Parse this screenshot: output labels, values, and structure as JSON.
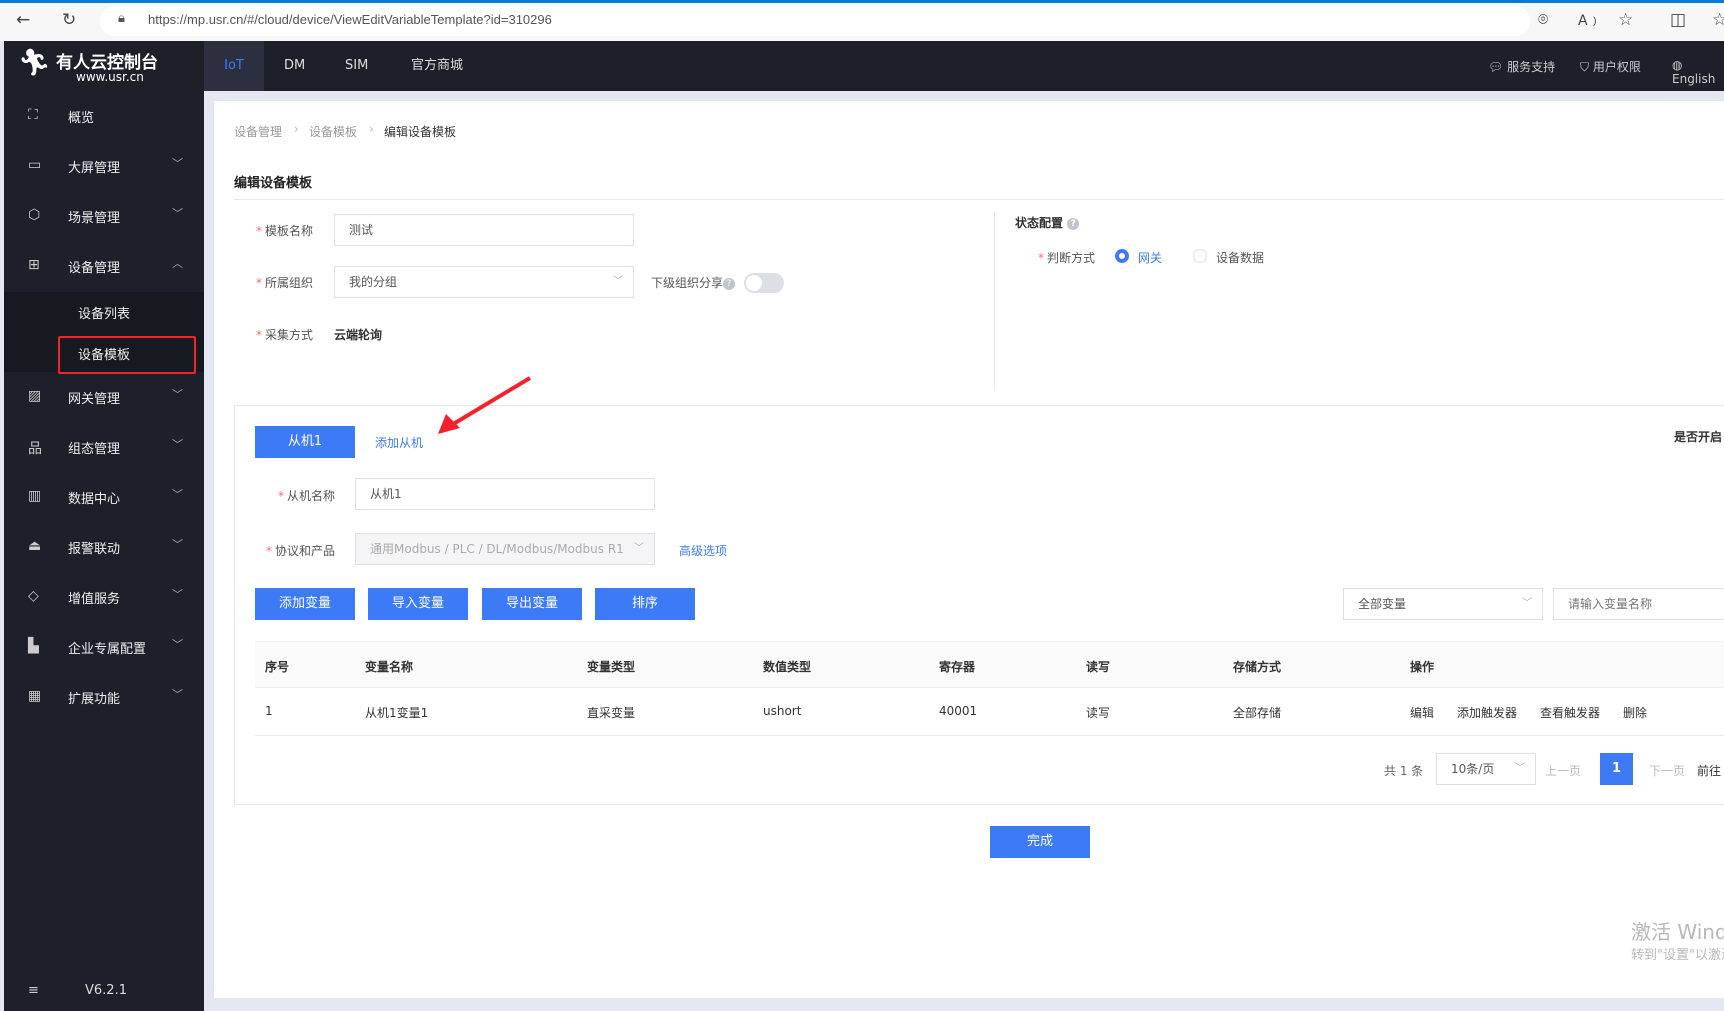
{
  "browser": {
    "url": "https://mp.usr.cn/#/cloud/device/ViewEditVariableTemplate?id=310296"
  },
  "header": {
    "logo_title": "有人云控制台",
    "logo_sub": "www.usr.cn",
    "tabs": [
      "IoT",
      "DM",
      "SIM",
      "官方商城"
    ],
    "active_tab": "IoT",
    "right": [
      {
        "icon": "chat-icon",
        "label": "服务支持"
      },
      {
        "icon": "shield-icon",
        "label": "用户权限"
      },
      {
        "icon": "globe-icon",
        "label": "English"
      }
    ]
  },
  "sidebar": {
    "items": [
      {
        "label": "概览",
        "icon": "overview-icon"
      },
      {
        "label": "大屏管理",
        "icon": "screen-icon"
      },
      {
        "label": "场景管理",
        "icon": "cube-icon"
      },
      {
        "label": "设备管理",
        "icon": "device-icon",
        "expanded": true,
        "children": [
          "设备列表",
          "设备模板"
        ],
        "selected_child": "设备模板"
      },
      {
        "label": "网关管理",
        "icon": "gateway-icon"
      },
      {
        "label": "组态管理",
        "icon": "hierarchy-icon"
      },
      {
        "label": "数据中心",
        "icon": "bar-chart-icon"
      },
      {
        "label": "报警联动",
        "icon": "alarm-icon"
      },
      {
        "label": "增值服务",
        "icon": "diamond-icon"
      },
      {
        "label": "企业专属配置",
        "icon": "building-icon"
      },
      {
        "label": "扩展功能",
        "icon": "grid-icon"
      }
    ],
    "version": "V6.2.1"
  },
  "breadcrumb": [
    "设备管理",
    "设备模板",
    "编辑设备模板"
  ],
  "page_title": "编辑设备模板",
  "form": {
    "template_name_label": "模板名称",
    "template_name_value": "测试",
    "org_label": "所属组织",
    "org_value": "我的分组",
    "share_label": "下级组织分享",
    "share_enabled": false,
    "collect_label": "采集方式",
    "collect_value": "云端轮询"
  },
  "status_config": {
    "title": "状态配置",
    "judge_label": "判断方式",
    "options": [
      "网关",
      "设备数据"
    ],
    "selected": "网关"
  },
  "slave": {
    "tab": "从机1",
    "add_label": "添加从机",
    "enable_label": "是否开启",
    "name_label": "从机名称",
    "name_value": "从机1",
    "protocol_label": "协议和产品",
    "protocol_value": "通用Modbus / PLC / DL/Modbus/Modbus R1",
    "advanced": "高级选项"
  },
  "toolbar": {
    "buttons": [
      "添加变量",
      "导入变量",
      "导出变量",
      "排序"
    ],
    "filter_value": "全部变量",
    "search_placeholder": "请输入变量名称"
  },
  "table": {
    "columns": [
      "序号",
      "变量名称",
      "变量类型",
      "数值类型",
      "寄存器",
      "读写",
      "存储方式",
      "操作"
    ],
    "rows": [
      {
        "cells": [
          "1",
          "从机1变量1",
          "直采变量",
          "ushort",
          "40001",
          "读写",
          "全部存储"
        ],
        "actions": [
          "编辑",
          "添加触发器",
          "查看触发器",
          "删除"
        ]
      }
    ]
  },
  "pagination": {
    "total": "共 1 条",
    "page_size": "10条/页",
    "prev": "上一页",
    "current": "1",
    "next": "下一页",
    "goto": "前往"
  },
  "done_label": "完成",
  "watermark": {
    "line1": "激活 Windows",
    "line2": "转到\"设置\"以激活"
  },
  "colors": {
    "primary": "#3d7bf6",
    "sidebar": "#1d1f2a",
    "highlight_box": "#f5222d"
  }
}
